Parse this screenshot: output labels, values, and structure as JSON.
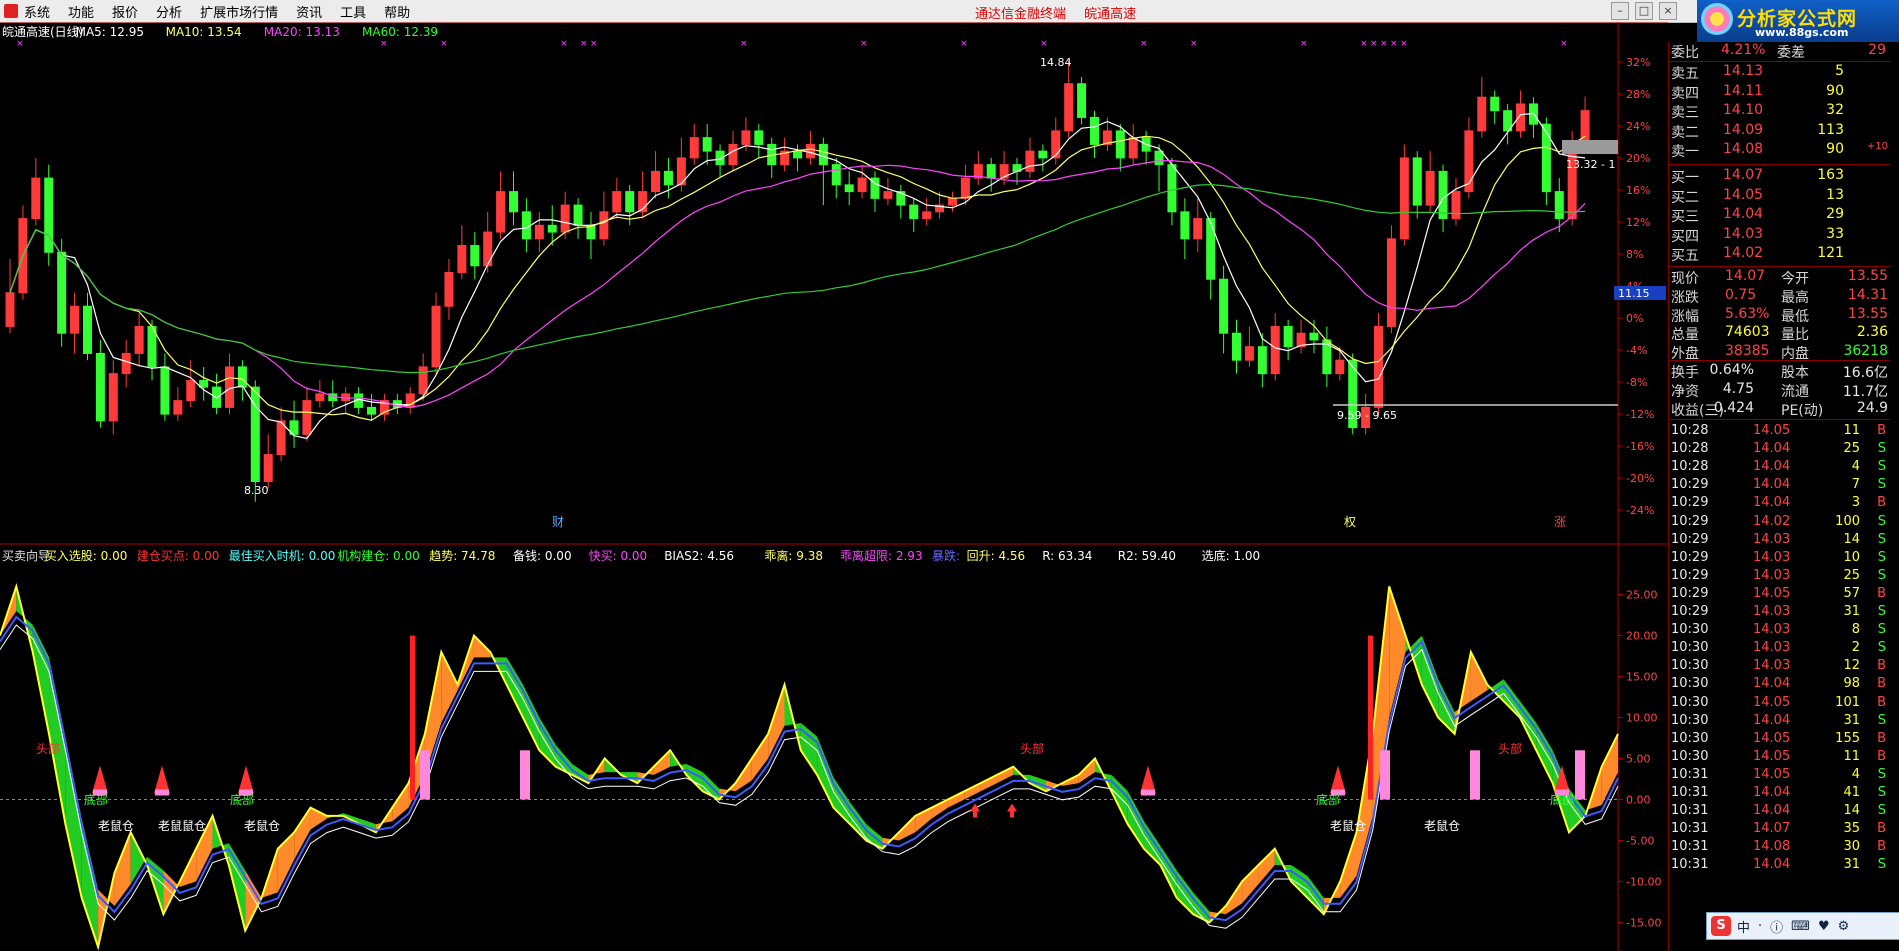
{
  "menubar": {
    "items": [
      "系统",
      "功能",
      "报价",
      "分析",
      "扩展市场行情",
      "资讯",
      "工具",
      "帮助"
    ],
    "center_titles": [
      "通达信金融终端",
      "皖通高速"
    ]
  },
  "logo": {
    "brand": "分析家公式网",
    "url_text": "www.88gs.com"
  },
  "top_panel": {
    "header": [
      {
        "text": "皖通高速(日线)",
        "color": "#ffffff"
      },
      {
        "text": "MA5: 12.95",
        "color": "#ffffff"
      },
      {
        "text": "MA10: 13.54",
        "color": "#ffff66"
      },
      {
        "text": "MA20: 13.13",
        "color": "#ff44ff"
      },
      {
        "text": "MA60: 12.39",
        "color": "#33ff33"
      }
    ],
    "y_ticks": [
      "32%",
      "28%",
      "24%",
      "20%",
      "16%",
      "12%",
      "8%",
      "4%",
      "0%",
      "-4%",
      "-8%",
      "-12%",
      "-16%",
      "-20%",
      "-24%"
    ],
    "annotations": {
      "high": "14.84",
      "low": "8.30",
      "range_low": "9.59 - 9.65",
      "range_high": "13.32 - 1",
      "price_tag": "11.15"
    },
    "markers": {
      "cai": "财",
      "quan": "权",
      "zhang": "涨"
    }
  },
  "bottom_panel": {
    "header": [
      {
        "text": "买卖向导",
        "color": "#e0e0e0"
      },
      {
        "text": "买入选股: 0.00",
        "color": "#ffff66"
      },
      {
        "text": "建仓买点: 0.00",
        "color": "#ff3333"
      },
      {
        "text": "最佳买入时机: 0.00",
        "color": "#55ffff"
      },
      {
        "text": "机构建仓: 0.00",
        "color": "#33ff33"
      },
      {
        "text": "趋势: 74.78",
        "color": "#ffff66"
      },
      {
        "text": "备钱: 0.00",
        "color": "#ffffff"
      },
      {
        "text": "快买: 0.00",
        "color": "#ff44ff"
      },
      {
        "text": "BIAS2: 4.56",
        "color": "#ffffff"
      },
      {
        "text": "乖离: 9.38",
        "color": "#ffff66"
      },
      {
        "text": "乖离超限: 2.93",
        "color": "#ff44ff"
      },
      {
        "text": "暴跌:",
        "color": "#6666ff"
      },
      {
        "text": "回升: 4.56",
        "color": "#ffff66"
      },
      {
        "text": "R: 63.34",
        "color": "#ffffff"
      },
      {
        "text": "R2: 59.40",
        "color": "#ffffff"
      },
      {
        "text": "选底: 1.00",
        "color": "#ffffff"
      }
    ],
    "y_ticks": [
      "25.00",
      "20.00",
      "15.00",
      "10.00",
      "5.00",
      "0.00",
      "-5.00",
      "-10.00",
      "-15.00"
    ],
    "labels": {
      "head": "头部",
      "bottom": "底部",
      "old_rat": "老鼠仓",
      "old_rat_double": "老鼠鼠仓"
    }
  },
  "quote": {
    "top_right": "29",
    "weibi": {
      "label": "委比",
      "value": "4.21%",
      "label2": "委差"
    },
    "asks": [
      {
        "label": "卖五",
        "price": "14.13",
        "vol": "5"
      },
      {
        "label": "卖四",
        "price": "14.11",
        "vol": "90"
      },
      {
        "label": "卖三",
        "price": "14.10",
        "vol": "32"
      },
      {
        "label": "卖二",
        "price": "14.09",
        "vol": "113"
      },
      {
        "label": "卖一",
        "price": "14.08",
        "vol": "90",
        "extra": "+10"
      }
    ],
    "bids": [
      {
        "label": "买一",
        "price": "14.07",
        "vol": "163"
      },
      {
        "label": "买二",
        "price": "14.05",
        "vol": "13"
      },
      {
        "label": "买三",
        "price": "14.04",
        "vol": "29"
      },
      {
        "label": "买四",
        "price": "14.03",
        "vol": "33"
      },
      {
        "label": "买五",
        "price": "14.02",
        "vol": "121"
      }
    ],
    "stats": [
      {
        "l1": "现价",
        "v1": "14.07",
        "c1": "red",
        "l2": "今开",
        "v2": "13.55",
        "c2": "red"
      },
      {
        "l1": "涨跌",
        "v1": "0.75",
        "c1": "red",
        "l2": "最高",
        "v2": "14.31",
        "c2": "red"
      },
      {
        "l1": "涨幅",
        "v1": "5.63%",
        "c1": "red",
        "l2": "最低",
        "v2": "13.55",
        "c2": "red"
      },
      {
        "l1": "总量",
        "v1": "74603",
        "c1": "yel",
        "l2": "量比",
        "v2": "2.36",
        "c2": "yel"
      },
      {
        "l1": "外盘",
        "v1": "38385",
        "c1": "red",
        "l2": "内盘",
        "v2": "36218",
        "c2": "grn"
      }
    ],
    "stats2": [
      {
        "l1": "换手",
        "v1": "0.64%",
        "l2": "股本",
        "v2": "16.6亿"
      },
      {
        "l1": "净资",
        "v1": "4.75",
        "l2": "流通",
        "v2": "11.7亿"
      },
      {
        "l1": "收益(三)",
        "v1": "0.424",
        "l2": "PE(动)",
        "v2": "24.9"
      }
    ],
    "ticks": [
      [
        "10:28",
        "14.05",
        "11",
        "B"
      ],
      [
        "10:28",
        "14.04",
        "25",
        "S"
      ],
      [
        "10:28",
        "14.04",
        "4",
        "S"
      ],
      [
        "10:29",
        "14.04",
        "7",
        "S"
      ],
      [
        "10:29",
        "14.04",
        "3",
        "B"
      ],
      [
        "10:29",
        "14.02",
        "100",
        "S"
      ],
      [
        "10:29",
        "14.03",
        "14",
        "S"
      ],
      [
        "10:29",
        "14.03",
        "10",
        "S"
      ],
      [
        "10:29",
        "14.03",
        "25",
        "S"
      ],
      [
        "10:29",
        "14.05",
        "57",
        "B"
      ],
      [
        "10:29",
        "14.03",
        "31",
        "S"
      ],
      [
        "10:30",
        "14.03",
        "8",
        "S"
      ],
      [
        "10:30",
        "14.03",
        "2",
        "S"
      ],
      [
        "10:30",
        "14.03",
        "12",
        "B"
      ],
      [
        "10:30",
        "14.04",
        "98",
        "B"
      ],
      [
        "10:30",
        "14.05",
        "101",
        "B"
      ],
      [
        "10:30",
        "14.04",
        "31",
        "S"
      ],
      [
        "10:30",
        "14.05",
        "155",
        "B"
      ],
      [
        "10:30",
        "14.05",
        "11",
        "B"
      ],
      [
        "10:31",
        "14.05",
        "4",
        "S"
      ],
      [
        "10:31",
        "14.04",
        "41",
        "S"
      ],
      [
        "10:31",
        "14.04",
        "14",
        "S"
      ],
      [
        "10:31",
        "14.07",
        "35",
        "B"
      ],
      [
        "10:31",
        "14.08",
        "30",
        "B"
      ],
      [
        "10:31",
        "14.04",
        "31",
        "S"
      ]
    ]
  },
  "ime": {
    "brand": "S",
    "items": [
      "中",
      "·",
      "ⓘ",
      "⌨",
      "♥",
      "⚙"
    ]
  },
  "chart_data": [
    {
      "type": "candlestick",
      "title": "皖通高速(日线)",
      "ylabel_ticks_percent": [
        32,
        28,
        24,
        20,
        16,
        12,
        8,
        4,
        0,
        -4,
        -8,
        -12,
        -16,
        -20,
        -24
      ],
      "price_ylim": [
        8.0,
        15.0
      ],
      "candles": [
        [
          10.9,
          11.4,
          11.9,
          10.8
        ],
        [
          11.4,
          12.5,
          12.7,
          11.3
        ],
        [
          12.5,
          13.1,
          13.4,
          12.4
        ],
        [
          13.1,
          12.0,
          13.3,
          11.8
        ],
        [
          12.0,
          10.8,
          12.2,
          10.6
        ],
        [
          10.8,
          11.2,
          11.4,
          10.5
        ],
        [
          11.2,
          10.5,
          11.4,
          10.4
        ],
        [
          10.5,
          9.5,
          10.7,
          9.4
        ],
        [
          9.5,
          10.2,
          10.4,
          9.3
        ],
        [
          10.2,
          10.5,
          10.7,
          10.0
        ],
        [
          10.5,
          10.9,
          11.1,
          10.3
        ],
        [
          10.9,
          10.3,
          11.0,
          10.1
        ],
        [
          10.3,
          9.6,
          10.5,
          9.5
        ],
        [
          9.6,
          9.8,
          10.0,
          9.5
        ],
        [
          9.8,
          10.1,
          10.4,
          9.7
        ],
        [
          10.1,
          10.0,
          10.3,
          9.8
        ],
        [
          10.0,
          9.7,
          10.2,
          9.6
        ],
        [
          9.7,
          10.3,
          10.5,
          9.6
        ],
        [
          10.3,
          10.0,
          10.4,
          9.8
        ],
        [
          10.0,
          8.6,
          10.1,
          8.3
        ],
        [
          8.6,
          9.0,
          9.3,
          8.5
        ],
        [
          9.0,
          9.5,
          9.7,
          8.9
        ],
        [
          9.5,
          9.3,
          9.8,
          9.1
        ],
        [
          9.3,
          9.8,
          10.0,
          9.2
        ],
        [
          9.8,
          9.9,
          10.1,
          9.7
        ],
        [
          9.9,
          9.8,
          10.1,
          9.7
        ],
        [
          9.8,
          9.9,
          10.0,
          9.6
        ],
        [
          9.9,
          9.7,
          10.0,
          9.6
        ],
        [
          9.7,
          9.6,
          9.9,
          9.5
        ],
        [
          9.6,
          9.8,
          9.9,
          9.5
        ],
        [
          9.8,
          9.7,
          9.9,
          9.6
        ],
        [
          9.7,
          9.9,
          10.0,
          9.6
        ],
        [
          9.9,
          10.3,
          10.5,
          9.8
        ],
        [
          10.3,
          11.2,
          11.4,
          10.2
        ],
        [
          11.2,
          11.7,
          11.9,
          11.0
        ],
        [
          11.7,
          12.1,
          12.4,
          11.6
        ],
        [
          12.1,
          11.8,
          12.3,
          11.6
        ],
        [
          11.8,
          12.3,
          12.6,
          11.7
        ],
        [
          12.3,
          12.9,
          13.2,
          12.2
        ],
        [
          12.9,
          12.6,
          13.2,
          12.4
        ],
        [
          12.6,
          12.2,
          12.8,
          12.0
        ],
        [
          12.2,
          12.4,
          12.6,
          12.0
        ],
        [
          12.4,
          12.3,
          12.7,
          12.1
        ],
        [
          12.3,
          12.7,
          12.9,
          12.2
        ],
        [
          12.7,
          12.4,
          12.8,
          12.2
        ],
        [
          12.4,
          12.2,
          12.6,
          11.9
        ],
        [
          12.2,
          12.6,
          12.9,
          12.1
        ],
        [
          12.6,
          12.9,
          13.1,
          12.5
        ],
        [
          12.9,
          12.6,
          13.0,
          12.4
        ],
        [
          12.6,
          12.9,
          13.2,
          12.5
        ],
        [
          12.9,
          13.2,
          13.5,
          12.8
        ],
        [
          13.2,
          13.0,
          13.4,
          12.8
        ],
        [
          13.0,
          13.4,
          13.7,
          12.9
        ],
        [
          13.4,
          13.7,
          13.9,
          13.3
        ],
        [
          13.7,
          13.5,
          13.9,
          13.3
        ],
        [
          13.5,
          13.3,
          13.6,
          13.1
        ],
        [
          13.3,
          13.6,
          13.8,
          13.2
        ],
        [
          13.6,
          13.8,
          14.0,
          13.5
        ],
        [
          13.8,
          13.6,
          13.9,
          13.4
        ],
        [
          13.6,
          13.3,
          13.7,
          13.1
        ],
        [
          13.3,
          13.5,
          13.7,
          13.2
        ],
        [
          13.5,
          13.4,
          13.6,
          13.2
        ],
        [
          13.4,
          13.6,
          13.8,
          13.3
        ],
        [
          13.6,
          13.3,
          13.7,
          12.7
        ],
        [
          13.3,
          13.0,
          13.4,
          12.8
        ],
        [
          13.0,
          12.9,
          13.2,
          12.7
        ],
        [
          12.9,
          13.1,
          13.3,
          12.8
        ],
        [
          13.1,
          12.8,
          13.2,
          12.6
        ],
        [
          12.8,
          12.9,
          13.1,
          12.7
        ],
        [
          12.9,
          12.7,
          13.0,
          12.5
        ],
        [
          12.7,
          12.5,
          12.8,
          12.3
        ],
        [
          12.5,
          12.6,
          12.8,
          12.4
        ],
        [
          12.6,
          12.7,
          12.9,
          12.5
        ],
        [
          12.7,
          12.8,
          12.9,
          12.6
        ],
        [
          12.8,
          13.1,
          13.3,
          12.7
        ],
        [
          13.1,
          13.3,
          13.5,
          13.0
        ],
        [
          13.3,
          13.1,
          13.4,
          12.9
        ],
        [
          13.1,
          13.3,
          13.5,
          13.0
        ],
        [
          13.3,
          13.2,
          13.4,
          13.0
        ],
        [
          13.2,
          13.5,
          13.7,
          13.1
        ],
        [
          13.5,
          13.4,
          13.6,
          13.2
        ],
        [
          13.4,
          13.8,
          14.0,
          13.3
        ],
        [
          13.8,
          14.5,
          14.84,
          13.7
        ],
        [
          14.5,
          14.0,
          14.6,
          13.9
        ],
        [
          14.0,
          13.6,
          14.1,
          13.4
        ],
        [
          13.6,
          13.8,
          14.0,
          13.5
        ],
        [
          13.8,
          13.4,
          13.9,
          13.2
        ],
        [
          13.4,
          13.7,
          13.9,
          13.3
        ],
        [
          13.7,
          13.5,
          13.8,
          13.3
        ],
        [
          13.5,
          13.3,
          13.6,
          12.9
        ],
        [
          13.3,
          12.6,
          13.4,
          12.4
        ],
        [
          12.6,
          12.2,
          12.8,
          11.9
        ],
        [
          12.2,
          12.5,
          12.8,
          12.0
        ],
        [
          12.5,
          11.6,
          12.6,
          11.3
        ],
        [
          11.6,
          10.8,
          11.8,
          10.5
        ],
        [
          10.8,
          10.4,
          11.0,
          10.2
        ],
        [
          10.4,
          10.6,
          10.9,
          10.3
        ],
        [
          10.6,
          10.2,
          10.8,
          10.0
        ],
        [
          10.2,
          10.9,
          11.1,
          10.1
        ],
        [
          10.9,
          10.6,
          11.0,
          10.4
        ],
        [
          10.6,
          10.8,
          11.0,
          10.5
        ],
        [
          10.8,
          10.7,
          11.0,
          10.5
        ],
        [
          10.7,
          10.2,
          10.9,
          10.0
        ],
        [
          10.2,
          10.4,
          10.6,
          10.1
        ],
        [
          10.4,
          9.4,
          10.5,
          9.3
        ],
        [
          9.4,
          9.7,
          9.9,
          9.3
        ],
        [
          9.7,
          10.9,
          11.1,
          9.6
        ],
        [
          10.9,
          12.2,
          12.4,
          10.8
        ],
        [
          12.2,
          13.4,
          13.6,
          12.1
        ],
        [
          13.4,
          12.7,
          13.5,
          12.5
        ],
        [
          12.7,
          13.2,
          13.5,
          12.6
        ],
        [
          13.2,
          12.5,
          13.3,
          12.3
        ],
        [
          12.5,
          12.9,
          13.1,
          12.4
        ],
        [
          12.9,
          13.8,
          14.0,
          12.8
        ],
        [
          13.8,
          14.3,
          14.6,
          13.7
        ],
        [
          14.3,
          14.1,
          14.4,
          13.9
        ],
        [
          14.1,
          13.8,
          14.2,
          13.6
        ],
        [
          13.8,
          14.2,
          14.4,
          13.7
        ],
        [
          14.2,
          13.9,
          14.3,
          13.7
        ],
        [
          13.9,
          12.9,
          14.0,
          12.7
        ],
        [
          12.9,
          12.5,
          13.1,
          12.3
        ],
        [
          12.5,
          13.6,
          13.8,
          12.4
        ],
        [
          13.6,
          14.1,
          14.31,
          13.55
        ]
      ],
      "ma_series": [
        "MA5",
        "MA10",
        "MA20",
        "MA60"
      ]
    },
    {
      "type": "area",
      "title": "买卖向导",
      "ylim": [
        -18,
        28
      ],
      "y_ticks": [
        25,
        20,
        15,
        10,
        5,
        0,
        -5,
        -10,
        -15
      ],
      "series": [
        {
          "name": "趋势",
          "values": [
            20,
            26,
            18,
            8,
            -3,
            -12,
            -18,
            -9,
            -4,
            -8,
            -14,
            -10,
            -6,
            -2,
            -8,
            -16,
            -12,
            -6,
            -4,
            -1,
            -2,
            -2,
            -3,
            -4,
            -1,
            2,
            8,
            18,
            14,
            20,
            18,
            14,
            10,
            6,
            4,
            3,
            2,
            5,
            3,
            2,
            4,
            6,
            3,
            1,
            0,
            2,
            5,
            8,
            14,
            6,
            3,
            -1,
            -3,
            -5,
            -6,
            -4,
            -2,
            -1,
            0,
            1,
            2,
            3,
            4,
            2,
            1,
            2,
            3,
            5,
            1,
            -3,
            -6,
            -8,
            -12,
            -14,
            -15,
            -13,
            -10,
            -8,
            -6,
            -10,
            -12,
            -14,
            -10,
            -4,
            8,
            26,
            20,
            14,
            10,
            8,
            18,
            14,
            12,
            10,
            6,
            2,
            -4,
            -2,
            4,
            8
          ]
        }
      ]
    }
  ]
}
